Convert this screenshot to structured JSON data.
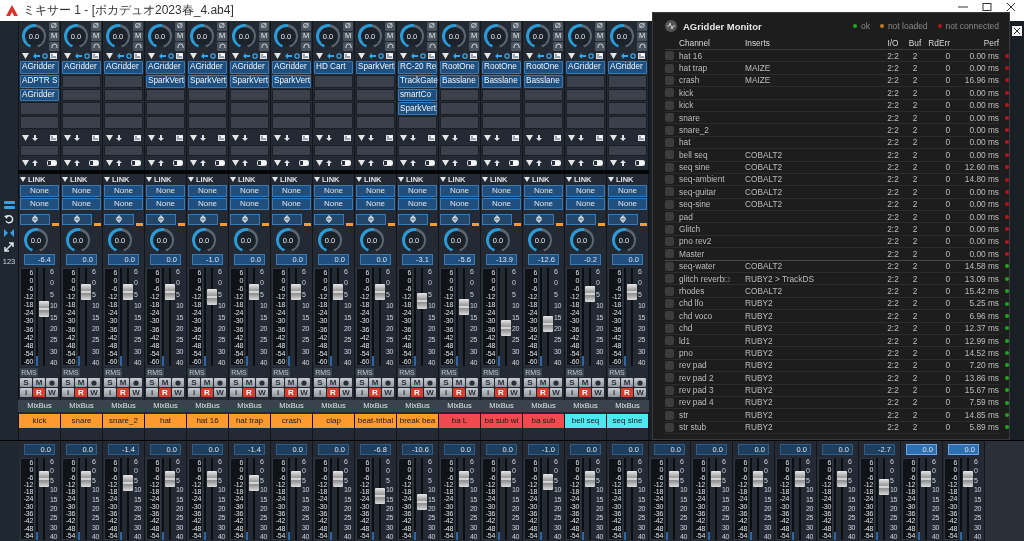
{
  "window": {
    "title": "ミキサー 1 - [ボカデュオ2023春_4.ab4]"
  },
  "mixer": {
    "sidebar_label": "123",
    "channels": [
      {
        "name": "kick",
        "color": "#ff9a2e",
        "pan": "0.0",
        "phase": "Ø",
        "mono": "M",
        "inserts": [
          "AGridder",
          "ADPTR S",
          "AGridder"
        ],
        "link": "LINK",
        "sends": [
          "None",
          "None"
        ],
        "send_level": "0.0",
        "volume": "-6.4",
        "level": 0.6,
        "meter_scale": [
          "6",
          "0",
          "-6",
          "-12",
          "-18",
          "-24",
          "-30",
          "-36",
          "-42",
          "-48",
          "-54",
          "-60"
        ],
        "fader_scale": [
          "6",
          "0",
          "5",
          "10",
          "15",
          "20",
          "25",
          "30",
          "40"
        ],
        "rms": "RMS",
        "buttons": [
          {
            "label": "S",
            "on": false
          },
          {
            "label": "M",
            "on": false
          },
          {
            "label": "i",
            "on": false
          },
          {
            "label": "R",
            "on": true
          },
          {
            "label": "W",
            "on": false
          }
        ],
        "output": "MixBus"
      },
      {
        "name": "snare",
        "color": "#ff9a2e",
        "pan": "0.0",
        "phase": "Ø",
        "mono": "M",
        "inserts": [
          "AGridder"
        ],
        "link": "LINK",
        "sends": [
          "None",
          "None"
        ],
        "send_level": "0.0",
        "volume": "0.0",
        "level": 0.8,
        "meter_scale": [
          "6",
          "0",
          "-6",
          "-12",
          "-18",
          "-24",
          "-30",
          "-36",
          "-42",
          "-48",
          "-54",
          "-60"
        ],
        "fader_scale": [
          "6",
          "0",
          "5",
          "10",
          "15",
          "20",
          "25",
          "30",
          "40"
        ],
        "rms": "RMS",
        "buttons": [
          {
            "label": "S",
            "on": false
          },
          {
            "label": "M",
            "on": false
          },
          {
            "label": "i",
            "on": false
          },
          {
            "label": "R",
            "on": true
          },
          {
            "label": "W",
            "on": false
          }
        ],
        "output": "MixBus"
      },
      {
        "name": "snare_2",
        "color": "#ff9a2e",
        "pan": "0.0",
        "phase": "Ø",
        "mono": "M",
        "inserts": [
          "AGridder"
        ],
        "link": "LINK",
        "sends": [
          "None",
          "None"
        ],
        "send_level": "0.0",
        "volume": "0.0",
        "level": 0.8,
        "meter_scale": [
          "6",
          "0",
          "-6",
          "-12",
          "-18",
          "-24",
          "-30",
          "-36",
          "-42",
          "-48",
          "-54",
          "-60"
        ],
        "fader_scale": [
          "6",
          "0",
          "5",
          "10",
          "15",
          "20",
          "25",
          "30",
          "40"
        ],
        "rms": "RMS",
        "buttons": [
          {
            "label": "S",
            "on": false
          },
          {
            "label": "M",
            "on": false
          },
          {
            "label": "i",
            "on": false
          },
          {
            "label": "R",
            "on": true
          },
          {
            "label": "W",
            "on": false
          }
        ],
        "output": "MixBus"
      },
      {
        "name": "hat",
        "color": "#ff9a2e",
        "pan": "0.0",
        "phase": "Ø",
        "mono": "M",
        "inserts": [
          "AGridder",
          "SparkVert"
        ],
        "link": "LINK",
        "sends": [
          "None",
          "None"
        ],
        "send_level": "0.0",
        "volume": "0.0",
        "level": 0.8,
        "meter_scale": [
          "6",
          "0",
          "-6",
          "-12",
          "-18",
          "-24",
          "-30",
          "-36",
          "-42",
          "-48",
          "-54",
          "-60"
        ],
        "fader_scale": [
          "6",
          "0",
          "5",
          "10",
          "15",
          "20",
          "25",
          "30",
          "40"
        ],
        "rms": "RMS",
        "buttons": [
          {
            "label": "S",
            "on": false
          },
          {
            "label": "M",
            "on": false
          },
          {
            "label": "i",
            "on": false
          },
          {
            "label": "R",
            "on": true
          },
          {
            "label": "W",
            "on": false
          }
        ],
        "output": "MixBus"
      },
      {
        "name": "hat 16",
        "color": "#ff9a2e",
        "pan": "0.0",
        "phase": "Ø",
        "mono": "M",
        "inserts": [
          "AGridder",
          "SparkVert"
        ],
        "link": "LINK",
        "sends": [
          "None",
          "None"
        ],
        "send_level": "0.0",
        "volume": "-1.0",
        "level": 0.75,
        "meter_scale": [
          "6",
          "0",
          "-6",
          "-12",
          "-18",
          "-24",
          "-30",
          "-36",
          "-42",
          "-48",
          "-54",
          "-60"
        ],
        "fader_scale": [
          "6",
          "0",
          "5",
          "10",
          "15",
          "20",
          "25",
          "30",
          "40"
        ],
        "rms": "RMS",
        "buttons": [
          {
            "label": "S",
            "on": false
          },
          {
            "label": "M",
            "on": false
          },
          {
            "label": "i",
            "on": false
          },
          {
            "label": "R",
            "on": true
          },
          {
            "label": "W",
            "on": false
          }
        ],
        "output": "MixBus"
      },
      {
        "name": "hat trap",
        "color": "#ff9a2e",
        "pan": "0.0",
        "phase": "Ø",
        "mono": "M",
        "inserts": [
          "AGridder",
          "SparkVert"
        ],
        "link": "LINK",
        "sends": [
          "None",
          "None"
        ],
        "send_level": "0.0",
        "volume": "0.0",
        "level": 0.8,
        "meter_scale": [
          "6",
          "0",
          "-6",
          "-12",
          "-18",
          "-24",
          "-30",
          "-36",
          "-42",
          "-48",
          "-54",
          "-60"
        ],
        "fader_scale": [
          "6",
          "0",
          "5",
          "10",
          "15",
          "20",
          "25",
          "30",
          "40"
        ],
        "rms": "RMS",
        "buttons": [
          {
            "label": "S",
            "on": false
          },
          {
            "label": "M",
            "on": false
          },
          {
            "label": "i",
            "on": false
          },
          {
            "label": "R",
            "on": true
          },
          {
            "label": "W",
            "on": false
          }
        ],
        "output": "MixBus"
      },
      {
        "name": "crash",
        "color": "#ff9a2e",
        "pan": "0.0",
        "phase": "Ø",
        "mono": "M",
        "inserts": [
          "AGridder",
          "SparkVert"
        ],
        "link": "LINK",
        "sends": [
          "None",
          "None"
        ],
        "send_level": "0.0",
        "volume": "0.0",
        "level": 0.8,
        "meter_scale": [
          "6",
          "0",
          "-6",
          "-12",
          "-18",
          "-24",
          "-30",
          "-36",
          "-42",
          "-48",
          "-54",
          "-60"
        ],
        "fader_scale": [
          "6",
          "0",
          "5",
          "10",
          "15",
          "20",
          "25",
          "30",
          "40"
        ],
        "rms": "RMS",
        "buttons": [
          {
            "label": "S",
            "on": false
          },
          {
            "label": "M",
            "on": false
          },
          {
            "label": "i",
            "on": false
          },
          {
            "label": "R",
            "on": true
          },
          {
            "label": "W",
            "on": false
          }
        ],
        "output": "MixBus"
      },
      {
        "name": "clap",
        "color": "#ff9a2e",
        "pan": "0.0",
        "phase": "Ø",
        "mono": "M",
        "inserts": [
          "HD Cart"
        ],
        "link": "LINK",
        "sends": [
          "None",
          "None"
        ],
        "send_level": "0.0",
        "volume": "0.0",
        "level": 0.8,
        "meter_scale": [
          "6",
          "0",
          "-6",
          "-12",
          "-18",
          "-24",
          "-30",
          "-36",
          "-42",
          "-48",
          "-54",
          "-60"
        ],
        "fader_scale": [
          "6",
          "0",
          "5",
          "10",
          "15",
          "20",
          "25",
          "30",
          "40"
        ],
        "rms": "RMS",
        "buttons": [
          {
            "label": "S",
            "on": false
          },
          {
            "label": "M",
            "on": false
          },
          {
            "label": "i",
            "on": false
          },
          {
            "label": "R",
            "on": true
          },
          {
            "label": "W",
            "on": false
          }
        ],
        "output": "MixBus"
      },
      {
        "name": "beat-tribal",
        "color": "#ff9a2e",
        "pan": "0.0",
        "phase": "Ø",
        "mono": "M",
        "inserts": [
          "SparkVert"
        ],
        "link": "LINK",
        "sends": [
          "None",
          "None"
        ],
        "send_level": "0.0",
        "volume": "0.0",
        "level": 0.8,
        "meter_scale": [
          "6",
          "0",
          "-6",
          "-12",
          "-18",
          "-24",
          "-30",
          "-36",
          "-42",
          "-48",
          "-54",
          "-60"
        ],
        "fader_scale": [
          "6",
          "0",
          "5",
          "10",
          "15",
          "20",
          "25",
          "30",
          "40"
        ],
        "rms": "RMS",
        "buttons": [
          {
            "label": "S",
            "on": false
          },
          {
            "label": "M",
            "on": false
          },
          {
            "label": "i",
            "on": false
          },
          {
            "label": "R",
            "on": true
          },
          {
            "label": "W",
            "on": false
          }
        ],
        "output": "MixBus"
      },
      {
        "name": "break bea",
        "color": "#ff9a2e",
        "pan": "0.0",
        "phase": "Ø",
        "mono": "M",
        "inserts": [
          "RC-20 Re",
          "TrackGate",
          "smartCo",
          "SparkVert"
        ],
        "link": "LINK",
        "sends": [
          "None",
          "None"
        ],
        "send_level": "0.0",
        "volume": "-3.1",
        "level": 0.7,
        "meter_scale": [
          "6",
          "0",
          "-6",
          "-12",
          "-18",
          "-24",
          "-30",
          "-36",
          "-42",
          "-48",
          "-54",
          "-60"
        ],
        "fader_scale": [
          "6",
          "0",
          "5",
          "10",
          "15",
          "20",
          "25",
          "30",
          "40"
        ],
        "rms": "RMS",
        "buttons": [
          {
            "label": "S",
            "on": false
          },
          {
            "label": "M",
            "on": false
          },
          {
            "label": "i",
            "on": false
          },
          {
            "label": "R",
            "on": true
          },
          {
            "label": "W",
            "on": false
          }
        ],
        "output": "MixBus"
      },
      {
        "name": "ba L",
        "color": "#f04a4e",
        "pan": "0.0",
        "phase": "Ø",
        "mono": "M",
        "inserts": [
          "RootOne",
          "Basslane"
        ],
        "link": "LINK",
        "sends": [
          "None",
          "None"
        ],
        "send_level": "0.0",
        "volume": "-5.6",
        "level": 0.62,
        "meter_scale": [
          "6",
          "0",
          "-6",
          "-12",
          "-18",
          "-24",
          "-30",
          "-36",
          "-42",
          "-48",
          "-54",
          "-60"
        ],
        "fader_scale": [
          "6",
          "0",
          "5",
          "10",
          "15",
          "20",
          "25",
          "30",
          "40"
        ],
        "rms": "RMS",
        "buttons": [
          {
            "label": "S",
            "on": false
          },
          {
            "label": "M",
            "on": false
          },
          {
            "label": "i",
            "on": false
          },
          {
            "label": "R",
            "on": true
          },
          {
            "label": "W",
            "on": false
          }
        ],
        "output": "MixBus"
      },
      {
        "name": "ba sub wi",
        "color": "#f04a4e",
        "pan": "0.0",
        "phase": "Ø",
        "mono": "M",
        "inserts": [
          "RootOne",
          "Basslane"
        ],
        "link": "LINK",
        "sends": [
          "None",
          "None"
        ],
        "send_level": "0.0",
        "volume": "-13.9",
        "level": 0.36,
        "meter_scale": [
          "6",
          "0",
          "-6",
          "-12",
          "-18",
          "-24",
          "-30",
          "-36",
          "-42",
          "-48",
          "-54",
          "-60"
        ],
        "fader_scale": [
          "6",
          "0",
          "5",
          "10",
          "15",
          "20",
          "25",
          "30",
          "40"
        ],
        "rms": "RMS",
        "buttons": [
          {
            "label": "S",
            "on": false
          },
          {
            "label": "M",
            "on": false
          },
          {
            "label": "i",
            "on": false
          },
          {
            "label": "R",
            "on": true
          },
          {
            "label": "W",
            "on": false
          }
        ],
        "output": "MixBus"
      },
      {
        "name": "ba sub",
        "color": "#f04a4e",
        "pan": "0.0",
        "phase": "Ø",
        "mono": "M",
        "inserts": [
          "RootOne",
          "Basslane"
        ],
        "link": "LINK",
        "sends": [
          "None",
          "None"
        ],
        "send_level": "0.0",
        "volume": "-12.6",
        "level": 0.42,
        "meter_scale": [
          "6",
          "0",
          "-6",
          "-12",
          "-18",
          "-24",
          "-30",
          "-36",
          "-42",
          "-48",
          "-54",
          "-60"
        ],
        "fader_scale": [
          "6",
          "0",
          "5",
          "10",
          "15",
          "20",
          "25",
          "30",
          "40"
        ],
        "rms": "RMS",
        "buttons": [
          {
            "label": "S",
            "on": false
          },
          {
            "label": "M",
            "on": false
          },
          {
            "label": "i",
            "on": false
          },
          {
            "label": "R",
            "on": true
          },
          {
            "label": "W",
            "on": false
          }
        ],
        "output": "MixBus"
      },
      {
        "name": "bell seq",
        "color": "#4de8f2",
        "pan": "0.0",
        "phase": "Ø",
        "mono": "M",
        "inserts": [
          "AGridder"
        ],
        "link": "LINK",
        "sends": [
          "None",
          "None"
        ],
        "send_level": "0.0",
        "volume": "-0.2",
        "level": 0.78,
        "meter_scale": [
          "6",
          "0",
          "-6",
          "-12",
          "-18",
          "-24",
          "-30",
          "-36",
          "-42",
          "-48",
          "-54",
          "-60"
        ],
        "fader_scale": [
          "6",
          "0",
          "5",
          "10",
          "15",
          "20",
          "25",
          "30",
          "40"
        ],
        "rms": "RMS",
        "buttons": [
          {
            "label": "S",
            "on": false
          },
          {
            "label": "M",
            "on": false
          },
          {
            "label": "i",
            "on": false
          },
          {
            "label": "R",
            "on": true
          },
          {
            "label": "W",
            "on": false
          }
        ],
        "output": "MixBus"
      },
      {
        "name": "seq sine",
        "color": "#4de8f2",
        "pan": "0.0",
        "phase": "Ø",
        "mono": "M",
        "inserts": [
          "AGridder"
        ],
        "link": "LINK",
        "sends": [
          "None",
          "None"
        ],
        "send_level": "0.0",
        "volume": "0.0",
        "level": 0.8,
        "meter_scale": [
          "6",
          "0",
          "-6",
          "-12",
          "-18",
          "-24",
          "-30",
          "-36",
          "-42",
          "-48",
          "-54",
          "-60"
        ],
        "fader_scale": [
          "6",
          "0",
          "5",
          "10",
          "15",
          "20",
          "25",
          "30",
          "40"
        ],
        "rms": "RMS",
        "buttons": [
          {
            "label": "S",
            "on": false
          },
          {
            "label": "M",
            "on": false
          },
          {
            "label": "i",
            "on": false
          },
          {
            "label": "R",
            "on": true
          },
          {
            "label": "W",
            "on": false
          }
        ],
        "output": "MixBus"
      }
    ],
    "lower_strips": [
      {
        "volume": "0.0",
        "level": 0.8,
        "selected": false,
        "meter_scale": [
          "6",
          "0",
          "-6",
          "-12",
          "-18",
          "-24",
          "-30",
          "-36",
          "-42",
          "-48",
          "-54"
        ],
        "fader_scale": [
          "6",
          "0",
          "5",
          "10",
          "15",
          "20",
          "25",
          "30",
          "40"
        ]
      },
      {
        "volume": "0.0",
        "level": 0.8,
        "selected": false,
        "meter_scale": [
          "6",
          "0",
          "-6",
          "-12",
          "-18",
          "-24",
          "-30",
          "-36",
          "-42",
          "-48",
          "-54"
        ],
        "fader_scale": [
          "6",
          "0",
          "5",
          "10",
          "15",
          "20",
          "25",
          "30",
          "40"
        ]
      },
      {
        "volume": "-1.4",
        "level": 0.74,
        "selected": false,
        "meter_scale": [
          "6",
          "0",
          "-6",
          "-12",
          "-18",
          "-24",
          "-30",
          "-36",
          "-42",
          "-48",
          "-54"
        ],
        "fader_scale": [
          "6",
          "0",
          "5",
          "10",
          "15",
          "20",
          "25",
          "30",
          "40"
        ]
      },
      {
        "volume": "0.0",
        "level": 0.8,
        "selected": false,
        "meter_scale": [
          "6",
          "0",
          "-6",
          "-12",
          "-18",
          "-24",
          "-30",
          "-36",
          "-42",
          "-48",
          "-54"
        ],
        "fader_scale": [
          "6",
          "0",
          "5",
          "10",
          "15",
          "20",
          "25",
          "30",
          "40"
        ]
      },
      {
        "volume": "0.0",
        "level": 0.8,
        "selected": false,
        "meter_scale": [
          "6",
          "0",
          "-6",
          "-12",
          "-18",
          "-24",
          "-30",
          "-36",
          "-42",
          "-48",
          "-54"
        ],
        "fader_scale": [
          "6",
          "0",
          "5",
          "10",
          "15",
          "20",
          "25",
          "30",
          "40"
        ]
      },
      {
        "volume": "-1.4",
        "level": 0.74,
        "selected": false,
        "meter_scale": [
          "6",
          "0",
          "-6",
          "-12",
          "-18",
          "-24",
          "-30",
          "-36",
          "-42",
          "-48",
          "-54"
        ],
        "fader_scale": [
          "6",
          "0",
          "5",
          "10",
          "15",
          "20",
          "25",
          "30",
          "40"
        ]
      },
      {
        "volume": "0.0",
        "level": 0.8,
        "selected": false,
        "meter_scale": [
          "6",
          "0",
          "-6",
          "-12",
          "-18",
          "-24",
          "-30",
          "-36",
          "-42",
          "-48",
          "-54"
        ],
        "fader_scale": [
          "6",
          "0",
          "5",
          "10",
          "15",
          "20",
          "25",
          "30",
          "40"
        ]
      },
      {
        "volume": "0.0",
        "level": 0.8,
        "selected": false,
        "meter_scale": [
          "6",
          "0",
          "-6",
          "-12",
          "-18",
          "-24",
          "-30",
          "-36",
          "-42",
          "-48",
          "-54"
        ],
        "fader_scale": [
          "6",
          "0",
          "5",
          "10",
          "15",
          "20",
          "25",
          "30",
          "40"
        ]
      },
      {
        "volume": "-6.8",
        "level": 0.55,
        "selected": false,
        "meter_scale": [
          "6",
          "0",
          "-6",
          "-12",
          "-18",
          "-24",
          "-30",
          "-36",
          "-42",
          "-48",
          "-54"
        ],
        "fader_scale": [
          "6",
          "0",
          "5",
          "10",
          "15",
          "20",
          "25",
          "30",
          "40"
        ]
      },
      {
        "volume": "-10.6",
        "level": 0.45,
        "selected": false,
        "meter_scale": [
          "6",
          "0",
          "-6",
          "-12",
          "-18",
          "-24",
          "-30",
          "-36",
          "-42",
          "-48",
          "-54"
        ],
        "fader_scale": [
          "6",
          "0",
          "5",
          "10",
          "15",
          "20",
          "25",
          "30",
          "40"
        ]
      },
      {
        "volume": "0.0",
        "level": 0.8,
        "selected": false,
        "meter_scale": [
          "6",
          "0",
          "-6",
          "-12",
          "-18",
          "-24",
          "-30",
          "-36",
          "-42",
          "-48",
          "-54"
        ],
        "fader_scale": [
          "6",
          "0",
          "5",
          "10",
          "15",
          "20",
          "25",
          "30",
          "40"
        ]
      },
      {
        "volume": "0.0",
        "level": 0.8,
        "selected": false,
        "meter_scale": [
          "6",
          "0",
          "-6",
          "-12",
          "-18",
          "-24",
          "-30",
          "-36",
          "-42",
          "-48",
          "-54"
        ],
        "fader_scale": [
          "6",
          "0",
          "5",
          "10",
          "15",
          "20",
          "25",
          "30",
          "40"
        ]
      },
      {
        "volume": "-1.0",
        "level": 0.76,
        "selected": false,
        "meter_scale": [
          "6",
          "0",
          "-6",
          "-12",
          "-18",
          "-24",
          "-30",
          "-36",
          "-42",
          "-48",
          "-54"
        ],
        "fader_scale": [
          "6",
          "0",
          "5",
          "10",
          "15",
          "20",
          "25",
          "30",
          "40"
        ]
      },
      {
        "volume": "0.0",
        "level": 0.8,
        "selected": false,
        "meter_scale": [
          "6",
          "0",
          "-6",
          "-12",
          "-18",
          "-24",
          "-30",
          "-36",
          "-42",
          "-48",
          "-54"
        ],
        "fader_scale": [
          "6",
          "0",
          "5",
          "10",
          "15",
          "20",
          "25",
          "30",
          "40"
        ]
      },
      {
        "volume": "0.0",
        "level": 0.8,
        "selected": false,
        "meter_scale": [
          "6",
          "0",
          "-6",
          "-12",
          "-18",
          "-24",
          "-30",
          "-36",
          "-42",
          "-48",
          "-54"
        ],
        "fader_scale": [
          "6",
          "0",
          "5",
          "10",
          "15",
          "20",
          "25",
          "30",
          "40"
        ]
      },
      {
        "volume": "0.0",
        "level": 0.8,
        "selected": false,
        "meter_scale": [
          "6",
          "0",
          "-6",
          "-12",
          "-18",
          "-24",
          "-30",
          "-36",
          "-42",
          "-48",
          "-54"
        ],
        "fader_scale": [
          "6",
          "0",
          "5",
          "10",
          "15",
          "20",
          "25",
          "30",
          "40"
        ]
      },
      {
        "volume": "0.0",
        "level": 0.8,
        "selected": false,
        "meter_scale": [
          "6",
          "0",
          "-6",
          "-12",
          "-18",
          "-24",
          "-30",
          "-36",
          "-42",
          "-48",
          "-54"
        ],
        "fader_scale": [
          "6",
          "0",
          "5",
          "10",
          "15",
          "20",
          "25",
          "30",
          "40"
        ]
      },
      {
        "volume": "0.0",
        "level": 0.8,
        "selected": false,
        "meter_scale": [
          "6",
          "0",
          "-6",
          "-12",
          "-18",
          "-24",
          "-30",
          "-36",
          "-42",
          "-48",
          "-54"
        ],
        "fader_scale": [
          "6",
          "0",
          "5",
          "10",
          "15",
          "20",
          "25",
          "30",
          "40"
        ]
      },
      {
        "volume": "0.0",
        "level": 0.8,
        "selected": false,
        "meter_scale": [
          "6",
          "0",
          "-6",
          "-12",
          "-18",
          "-24",
          "-30",
          "-36",
          "-42",
          "-48",
          "-54"
        ],
        "fader_scale": [
          "6",
          "0",
          "5",
          "10",
          "15",
          "20",
          "25",
          "30",
          "40"
        ]
      },
      {
        "volume": "0.0",
        "level": 0.8,
        "selected": false,
        "meter_scale": [
          "6",
          "0",
          "-6",
          "-12",
          "-18",
          "-24",
          "-30",
          "-36",
          "-42",
          "-48",
          "-54"
        ],
        "fader_scale": [
          "6",
          "0",
          "5",
          "10",
          "15",
          "20",
          "25",
          "30",
          "40"
        ]
      },
      {
        "volume": "-2.7",
        "level": 0.68,
        "selected": false,
        "meter_scale": [
          "6",
          "0",
          "-6",
          "-12",
          "-18",
          "-24",
          "-30",
          "-36",
          "-42",
          "-48",
          "-54"
        ],
        "fader_scale": [
          "6",
          "0",
          "5",
          "10",
          "15",
          "20",
          "25",
          "30",
          "40"
        ]
      },
      {
        "volume": "0.0",
        "level": 0.8,
        "selected": true,
        "meter_scale": [
          "6",
          "0",
          "-6",
          "-12",
          "-18",
          "-24",
          "-30",
          "-36",
          "-42",
          "-48",
          "-54"
        ],
        "fader_scale": [
          "6",
          "0",
          "5",
          "10",
          "15",
          "20",
          "25",
          "30",
          "40"
        ]
      },
      {
        "volume": "0.0",
        "level": 0.8,
        "selected": true,
        "meter_scale": [
          "6",
          "0",
          "-6",
          "-12",
          "-18",
          "-24",
          "-30",
          "-36",
          "-42",
          "-48",
          "-54"
        ],
        "fader_scale": [
          "6",
          "0",
          "5",
          "10",
          "15",
          "20",
          "25",
          "30",
          "40"
        ]
      }
    ]
  },
  "monitor": {
    "title": "AGridder Monitor",
    "legend": [
      {
        "label": "ok",
        "color": "#1fa51f"
      },
      {
        "label": "not loaded",
        "color": "#c27a17"
      },
      {
        "label": "not connected",
        "color": "#b3161a"
      }
    ],
    "columns": [
      "Channel",
      "Inserts",
      "I/O",
      "Buf",
      "RdErr",
      "Perf"
    ],
    "rows": [
      {
        "checked": false,
        "channel": "hat 16",
        "io": "2:2",
        "buf": "2",
        "rderr": "0",
        "perf": "0.00 ms",
        "color": "#b3161a"
      },
      {
        "checked": false,
        "channel": "hat trap",
        "inserts": "MAIZE",
        "io": "2:2",
        "buf": "2",
        "rderr": "0",
        "perf": "0.00 ms",
        "color": "#b3161a"
      },
      {
        "checked": false,
        "channel": "crash",
        "inserts": "MAIZE",
        "io": "2:2",
        "buf": "2",
        "rderr": "0",
        "perf": "16.96 ms",
        "color": "#b3161a"
      },
      {
        "checked": false,
        "channel": "kick",
        "io": "2:2",
        "buf": "2",
        "rderr": "0",
        "perf": "0.00 ms",
        "color": "#b3161a"
      },
      {
        "checked": false,
        "channel": "kick",
        "io": "2:2",
        "buf": "2",
        "rderr": "0",
        "perf": "0.00 ms",
        "color": "#b3161a"
      },
      {
        "checked": false,
        "channel": "snare",
        "io": "2:2",
        "buf": "2",
        "rderr": "0",
        "perf": "0.00 ms",
        "color": "#b3161a"
      },
      {
        "checked": false,
        "channel": "snare_2",
        "io": "2:2",
        "buf": "2",
        "rderr": "0",
        "perf": "0.00 ms",
        "color": "#b3161a"
      },
      {
        "checked": false,
        "channel": "hat",
        "io": "2:2",
        "buf": "2",
        "rderr": "0",
        "perf": "0.00 ms",
        "color": "#b3161a"
      },
      {
        "checked": false,
        "channel": "bell seq",
        "inserts": "COBALT2",
        "io": "2:2",
        "buf": "2",
        "rderr": "0",
        "perf": "0.00 ms",
        "color": "#b3161a"
      },
      {
        "checked": false,
        "channel": "seq sine",
        "inserts": "COBALT2",
        "io": "2:2",
        "buf": "2",
        "rderr": "0",
        "perf": "12.60 ms",
        "color": "#b3161a"
      },
      {
        "checked": false,
        "channel": "seq-ambient",
        "inserts": "COBALT2",
        "io": "2:2",
        "buf": "2",
        "rderr": "0",
        "perf": "14.80 ms",
        "color": "#b3161a"
      },
      {
        "checked": false,
        "channel": "seq-guitar",
        "inserts": "COBALT2",
        "io": "2:2",
        "buf": "2",
        "rderr": "0",
        "perf": "0.00 ms",
        "color": "#b3161a"
      },
      {
        "checked": false,
        "channel": "seq-sine",
        "inserts": "COBALT2",
        "io": "2:2",
        "buf": "2",
        "rderr": "0",
        "perf": "0.00 ms",
        "color": "#b3161a"
      },
      {
        "checked": false,
        "channel": "pad",
        "io": "2:2",
        "buf": "2",
        "rderr": "0",
        "perf": "0.00 ms",
        "color": "#b3161a"
      },
      {
        "checked": false,
        "channel": "Glitch",
        "io": "2:2",
        "buf": "2",
        "rderr": "0",
        "perf": "0.00 ms",
        "color": "#b3161a"
      },
      {
        "checked": false,
        "channel": "pno rev2",
        "io": "2:2",
        "buf": "2",
        "rderr": "0",
        "perf": "0.00 ms",
        "color": "#b3161a"
      },
      {
        "checked": false,
        "channel": "Master",
        "io": "2:2",
        "buf": "2",
        "rderr": "0",
        "perf": "0.00 ms",
        "color": "#b3161a"
      },
      {
        "checked": false,
        "channel": "seq-water",
        "inserts": "COBALT2",
        "io": "2:2",
        "buf": "2",
        "rderr": "0",
        "perf": "14.58 ms",
        "color": "#1fa51f"
      },
      {
        "checked": false,
        "channel": "glitch reverb□",
        "inserts": "RUBY2 > TrackDS",
        "io": "2:2",
        "buf": "2",
        "rderr": "0",
        "perf": "13.09 ms",
        "color": "#1fa51f"
      },
      {
        "checked": false,
        "channel": "rhodes",
        "inserts": "COBALT2",
        "io": "2:2",
        "buf": "2",
        "rderr": "0",
        "perf": "15.42 ms",
        "color": "#1fa51f"
      },
      {
        "checked": false,
        "channel": "chd lfo",
        "inserts": "RUBY2",
        "io": "2:2",
        "buf": "2",
        "rderr": "0",
        "perf": "5.25 ms",
        "color": "#1fa51f"
      },
      {
        "checked": false,
        "channel": "chd voco",
        "inserts": "RUBY2",
        "io": "2:2",
        "buf": "2",
        "rderr": "0",
        "perf": "6.96 ms",
        "color": "#1fa51f"
      },
      {
        "checked": false,
        "channel": "chd",
        "inserts": "RUBY2",
        "io": "2:2",
        "buf": "2",
        "rderr": "0",
        "perf": "12.37 ms",
        "color": "#1fa51f"
      },
      {
        "checked": false,
        "channel": "ld1",
        "inserts": "RUBY2",
        "io": "2:2",
        "buf": "2",
        "rderr": "0",
        "perf": "12.99 ms",
        "color": "#1fa51f"
      },
      {
        "checked": false,
        "channel": "pno",
        "inserts": "RUBY2",
        "io": "2:2",
        "buf": "2",
        "rderr": "0",
        "perf": "14.52 ms",
        "color": "#1fa51f"
      },
      {
        "checked": false,
        "channel": "rev pad",
        "inserts": "RUBY2",
        "io": "2:2",
        "buf": "2",
        "rderr": "0",
        "perf": "7.20 ms",
        "color": "#1fa51f"
      },
      {
        "checked": false,
        "channel": "rev pad 2",
        "inserts": "RUBY2",
        "io": "2:2",
        "buf": "2",
        "rderr": "0",
        "perf": "13.86 ms",
        "color": "#1fa51f"
      },
      {
        "checked": false,
        "channel": "rev pad 3",
        "inserts": "RUBY2",
        "io": "2:2",
        "buf": "2",
        "rderr": "0",
        "perf": "15.67 ms",
        "color": "#1fa51f"
      },
      {
        "checked": false,
        "channel": "rev pad 4",
        "inserts": "RUBY2",
        "io": "2:2",
        "buf": "2",
        "rderr": "0",
        "perf": "7.59 ms",
        "color": "#1fa51f"
      },
      {
        "checked": false,
        "channel": "str",
        "inserts": "RUBY2",
        "io": "2:2",
        "buf": "2",
        "rderr": "0",
        "perf": "14.85 ms",
        "color": "#1fa51f"
      },
      {
        "checked": false,
        "channel": "str stub",
        "inserts": "RUBY2",
        "io": "2:2",
        "buf": "2",
        "rderr": "0",
        "perf": "5.89 ms",
        "color": "#1fa51f"
      }
    ]
  }
}
